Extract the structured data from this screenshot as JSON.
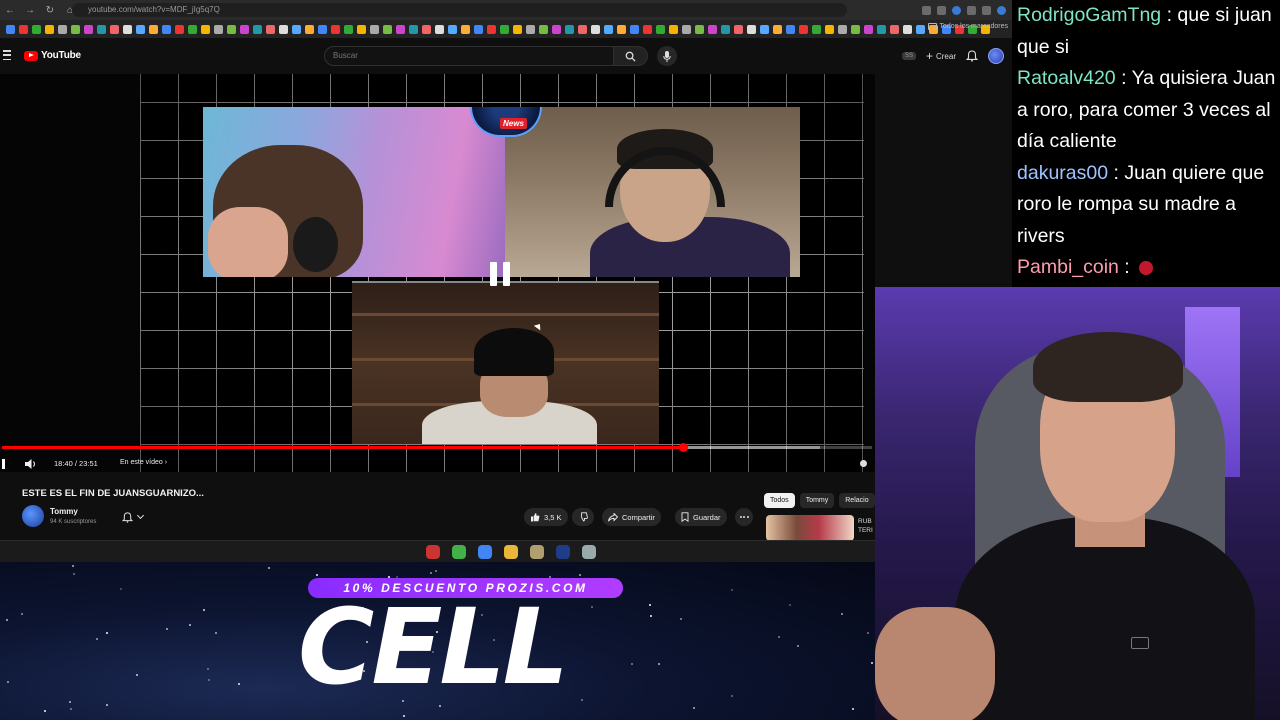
{
  "browser": {
    "url": "youtube.com/watch?v=MDF_jIg5q7Q",
    "bookmarks_folder": "Todos los marcadores"
  },
  "youtube": {
    "logo_text": "YouTube",
    "search_placeholder": "Buscar",
    "create_label": "Crear",
    "cc_label": "SS"
  },
  "player": {
    "time_display": "18:40 / 23:51",
    "progress_fraction": 0.783,
    "buffer_fraction": 0.94,
    "chapter_label": "En este vídeo",
    "overlay_badge": "News",
    "state": "paused"
  },
  "video": {
    "title": "ESTE ES EL FIN DE JUANSGUARNIZO...",
    "channel_name": "Tommy",
    "subscribers": "94 K suscriptores",
    "like_count": "3,5 K",
    "share_label": "Compartir",
    "save_label": "Guardar"
  },
  "chips": [
    "Todos",
    "Tommy",
    "Relacio"
  ],
  "recommendation": {
    "text_line1": "RUB",
    "text_line2": "TERI"
  },
  "dock": {
    "icon_colors": [
      "#c33",
      "#43b04a",
      "#4285f4",
      "#e8b73a",
      "#b0a070",
      "#1f3c88",
      "#9aa"
    ]
  },
  "overlay": {
    "promo": "10% DESCUENTO PROZIS.COM",
    "brand_word": "CELL"
  },
  "chat": {
    "messages": [
      {
        "user": "RodrigoGamTng",
        "text": "que si juan que si",
        "color": "#7fe4c7"
      },
      {
        "user": "Ratoalv420",
        "text": "Ya quisiera Juan a roro, para comer 3 veces al día caliente",
        "color": "#7fe4c7"
      },
      {
        "user": "dakuras00",
        "text": "Juan quiere que roro le rompa su madre a rivers",
        "color": "#9fc3ff"
      },
      {
        "user": "Pambi_coin",
        "text": "",
        "color": "#ff9ab0"
      }
    ]
  }
}
